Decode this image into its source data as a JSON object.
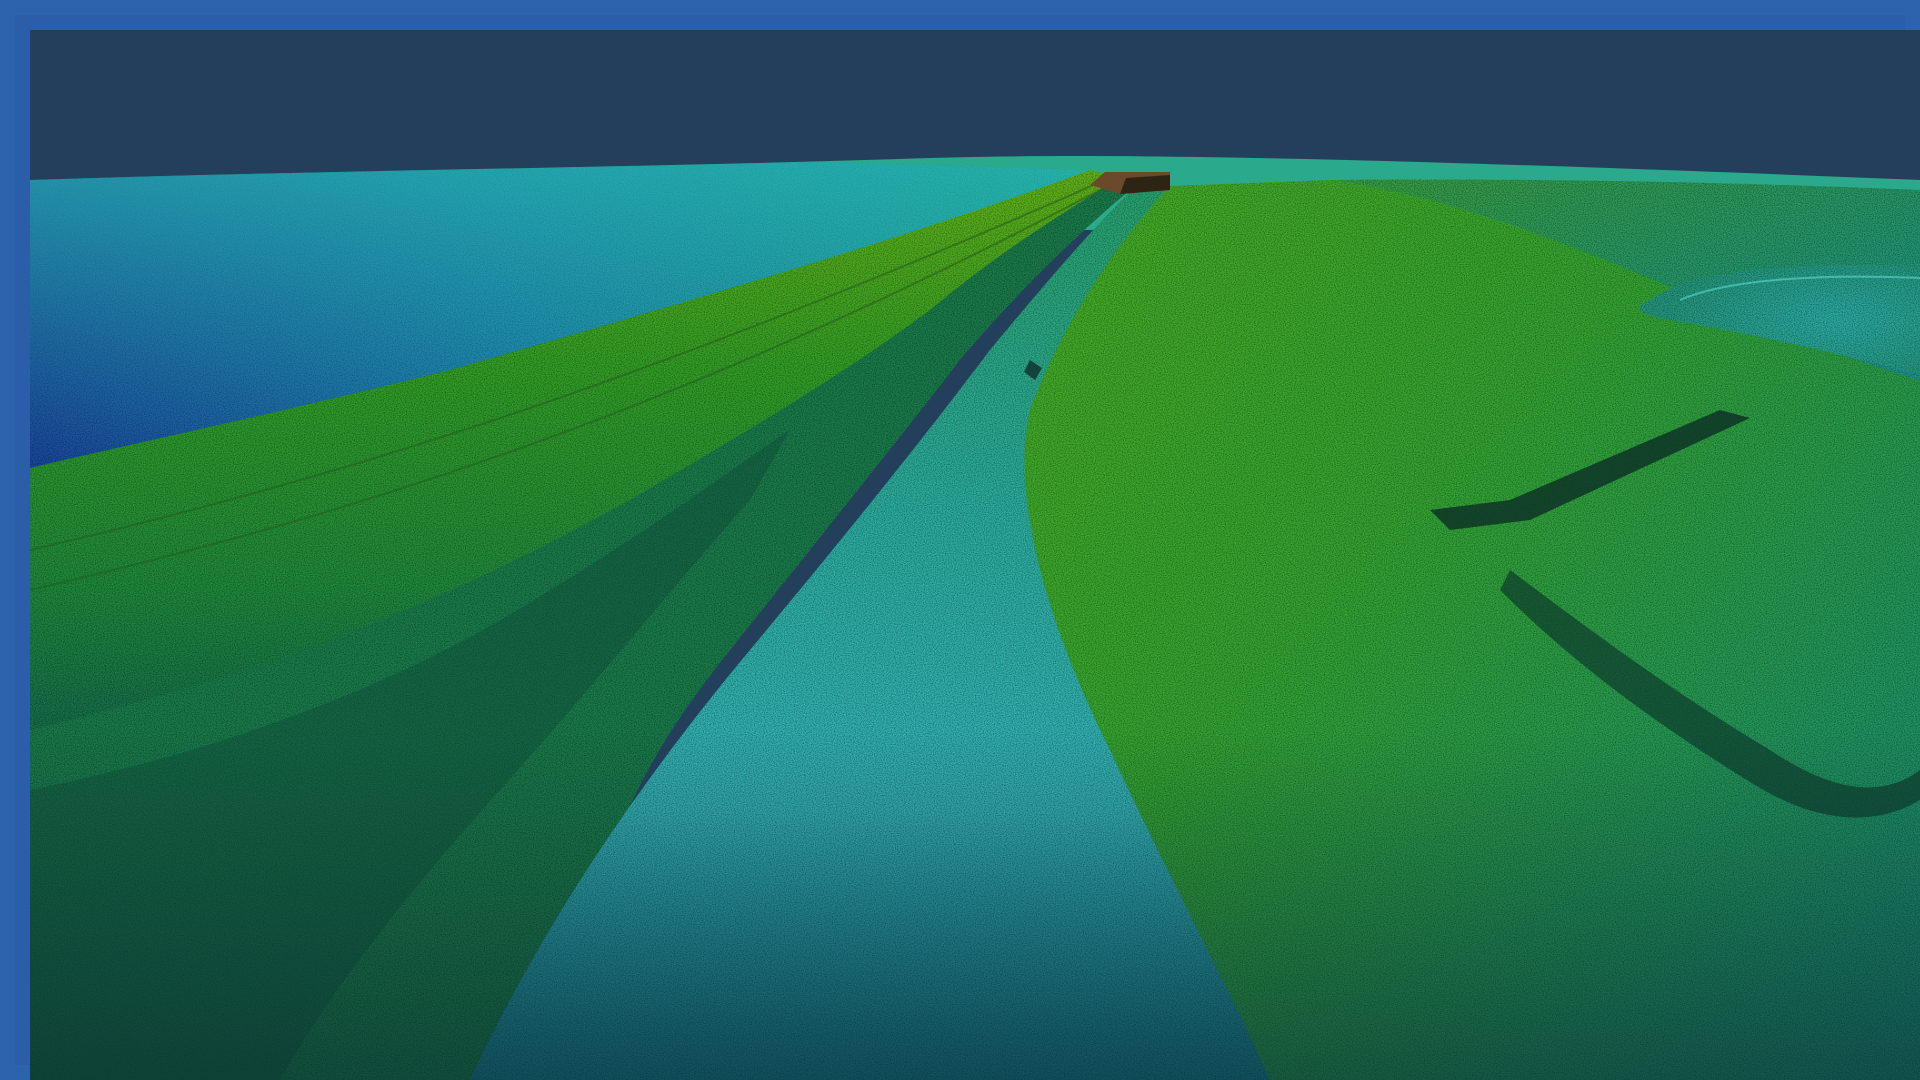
{
  "image": {
    "subject": "",
    "colors": {
      "frame": "#2d62ad",
      "sky": "#243f5c",
      "deep_blue": "#1f4fb0",
      "teal": "#1fb8c8",
      "cyan": "#3cd8d8",
      "green": "#3ab52a",
      "lime": "#7ccf20",
      "shadow": "#0e2a20"
    }
  }
}
